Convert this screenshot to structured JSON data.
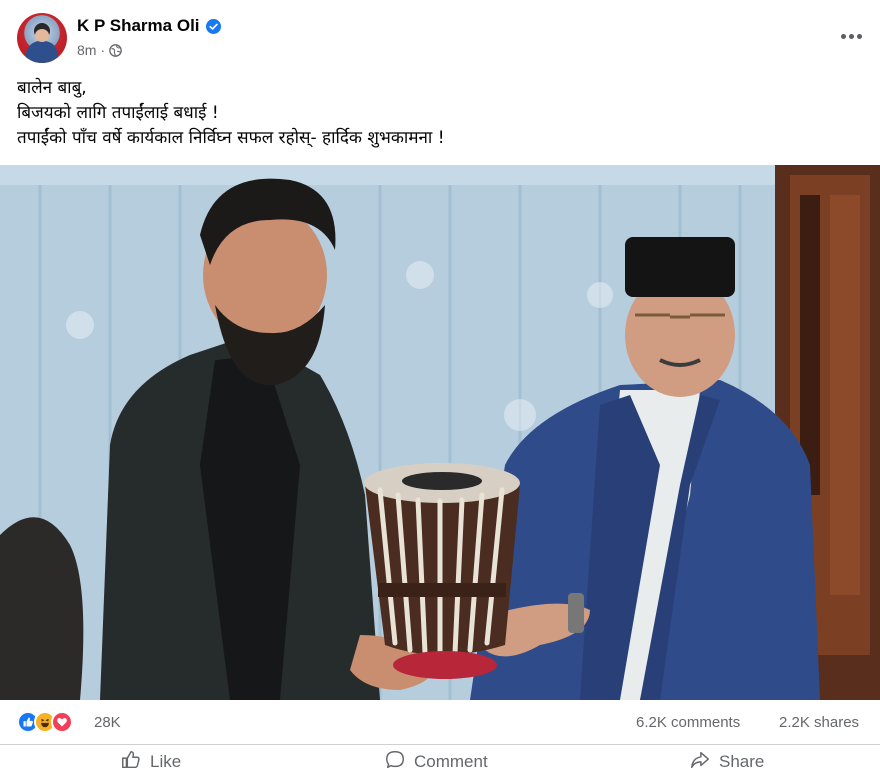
{
  "post": {
    "author": "K P Sharma Oli",
    "timestamp": "8m",
    "separator": "·",
    "lines": [
      "बालेन बाबु,",
      "बिजयको लागि तपाईंलाई बधाई !",
      "तपाईंको पाँच वर्षे कार्यकाल निर्विघ्न सफल रहोस्- हार्दिक शुभकामना !"
    ]
  },
  "stats": {
    "reactions": "28K",
    "comments": "6.2K comments",
    "shares": "2.2K shares"
  },
  "actions": {
    "like": "Like",
    "comment": "Comment",
    "share": "Share"
  },
  "icons": {
    "verified": "verified-badge-icon",
    "privacy": "globe-icon",
    "more": "more-options-icon",
    "reactions": [
      "like-reaction-icon",
      "haha-reaction-icon",
      "love-reaction-icon"
    ]
  },
  "colors": {
    "brand_blue": "#1877f2",
    "secondary_text": "#65676b",
    "primary_text": "#050505"
  }
}
